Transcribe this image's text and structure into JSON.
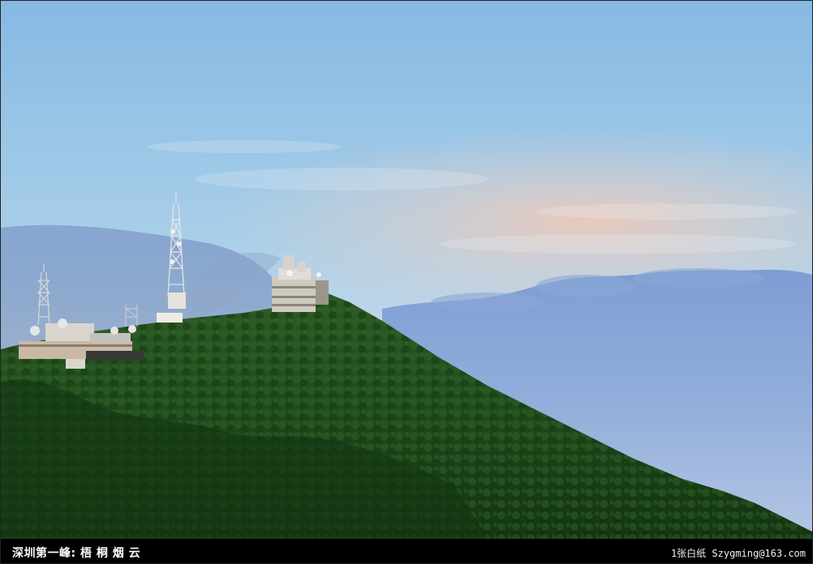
{
  "photo": {
    "subject": "mountain",
    "colors": {
      "sky_top": "#7fb4e0",
      "sky_mid": "#a6cbe8",
      "sky_glow": "#f2c9b6",
      "cloud_sea": "#7e9fd2",
      "forest": "#1f4a1c",
      "forest_dark": "#0f2a0e",
      "building": "#d8d4cc"
    }
  },
  "caption": {
    "left": "深圳第一峰: 梧 桐 烟 云",
    "right": "1张白纸 Szygming@163.com"
  }
}
